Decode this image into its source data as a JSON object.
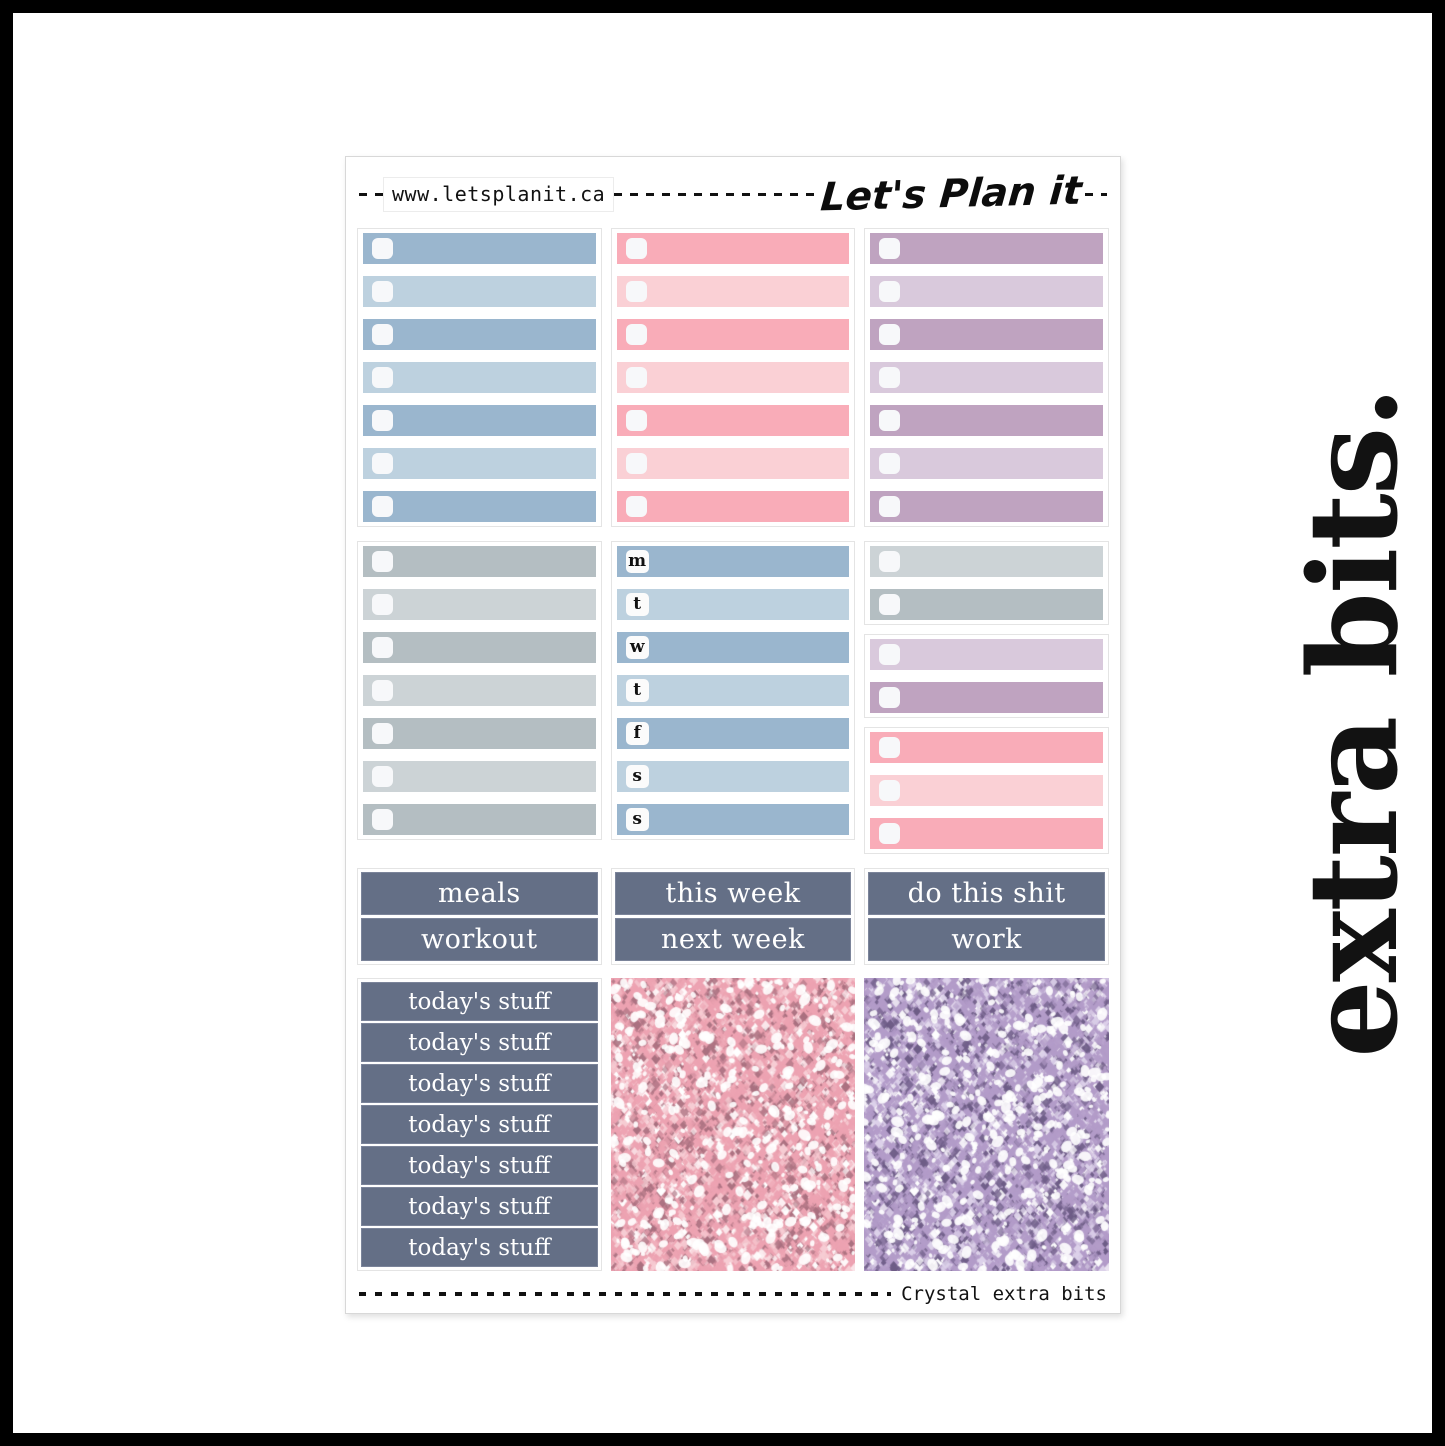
{
  "frame": {
    "border_color": "#000000"
  },
  "side_title": "extra bits.",
  "sheet": {
    "header": {
      "url": "www.letsplanit.ca",
      "brand": "Let's Plan it"
    },
    "footer": {
      "label": "Crystal extra bits"
    }
  },
  "palette": {
    "blue_dark": "#9ab6ce",
    "blue_light": "#bdd1df",
    "pink_dark": "#f9acb8",
    "pink_light": "#fad0d5",
    "purple_dark": "#bfa3c0",
    "purple_light": "#d9c9dc",
    "gray_dark": "#b4bec2",
    "gray_light": "#ccd3d6",
    "slate": "#646f86",
    "slate_border": "#7b849a",
    "checkbox": "#f7f8fa",
    "glitter_pink": "#eda3b2",
    "glitter_purple": "#b39cc9"
  },
  "section1": {
    "columns": [
      {
        "name": "blue-checklist",
        "rows": [
          {
            "fill": "#9ab6ce"
          },
          {
            "fill": "#bdd1df"
          },
          {
            "fill": "#9ab6ce"
          },
          {
            "fill": "#bdd1df"
          },
          {
            "fill": "#9ab6ce"
          },
          {
            "fill": "#bdd1df"
          },
          {
            "fill": "#9ab6ce"
          }
        ]
      },
      {
        "name": "pink-checklist",
        "rows": [
          {
            "fill": "#f9acb8"
          },
          {
            "fill": "#fad0d5"
          },
          {
            "fill": "#f9acb8"
          },
          {
            "fill": "#fad0d5"
          },
          {
            "fill": "#f9acb8"
          },
          {
            "fill": "#fad0d5"
          },
          {
            "fill": "#f9acb8"
          }
        ]
      },
      {
        "name": "purple-checklist",
        "rows": [
          {
            "fill": "#bfa3c0"
          },
          {
            "fill": "#d9c9dc"
          },
          {
            "fill": "#bfa3c0"
          },
          {
            "fill": "#d9c9dc"
          },
          {
            "fill": "#bfa3c0"
          },
          {
            "fill": "#d9c9dc"
          },
          {
            "fill": "#bfa3c0"
          }
        ]
      }
    ]
  },
  "section2": {
    "gray_column": {
      "name": "gray-checklist",
      "rows": [
        {
          "fill": "#b4bec2"
        },
        {
          "fill": "#ccd3d6"
        },
        {
          "fill": "#b4bec2"
        },
        {
          "fill": "#ccd3d6"
        },
        {
          "fill": "#b4bec2"
        },
        {
          "fill": "#ccd3d6"
        },
        {
          "fill": "#b4bec2"
        }
      ]
    },
    "days_column": {
      "name": "weekday-rows",
      "rows": [
        {
          "letter": "m",
          "fill": "#9ab6ce"
        },
        {
          "letter": "t",
          "fill": "#bdd1df"
        },
        {
          "letter": "w",
          "fill": "#9ab6ce"
        },
        {
          "letter": "t",
          "fill": "#bdd1df"
        },
        {
          "letter": "f",
          "fill": "#9ab6ce"
        },
        {
          "letter": "s",
          "fill": "#bdd1df"
        },
        {
          "letter": "s",
          "fill": "#9ab6ce"
        }
      ]
    },
    "mixed_column": {
      "groups": [
        {
          "name": "gray-pair",
          "rows": [
            {
              "fill": "#ccd3d6"
            },
            {
              "fill": "#b4bec2"
            }
          ]
        },
        {
          "name": "purple-pair",
          "rows": [
            {
              "fill": "#d9c9dc"
            },
            {
              "fill": "#bfa3c0"
            }
          ]
        },
        {
          "name": "pink-trio",
          "rows": [
            {
              "fill": "#f9acb8"
            },
            {
              "fill": "#fad0d5"
            },
            {
              "fill": "#f9acb8"
            }
          ]
        }
      ]
    }
  },
  "section3": {
    "columns": [
      {
        "name": "labels-col-1",
        "labels": [
          "meals",
          "workout"
        ]
      },
      {
        "name": "labels-col-2",
        "labels": [
          "this week",
          "next week"
        ]
      },
      {
        "name": "labels-col-3",
        "labels": [
          "do this shit",
          "work"
        ]
      }
    ]
  },
  "section4": {
    "today_labels": [
      "today's stuff",
      "today's stuff",
      "today's stuff",
      "today's stuff",
      "today's stuff",
      "today's stuff",
      "today's stuff"
    ],
    "glitter_panels": [
      {
        "name": "pink-glitter-panel",
        "color": "#eda3b2"
      },
      {
        "name": "purple-glitter-panel",
        "color": "#b39cc9"
      }
    ]
  }
}
